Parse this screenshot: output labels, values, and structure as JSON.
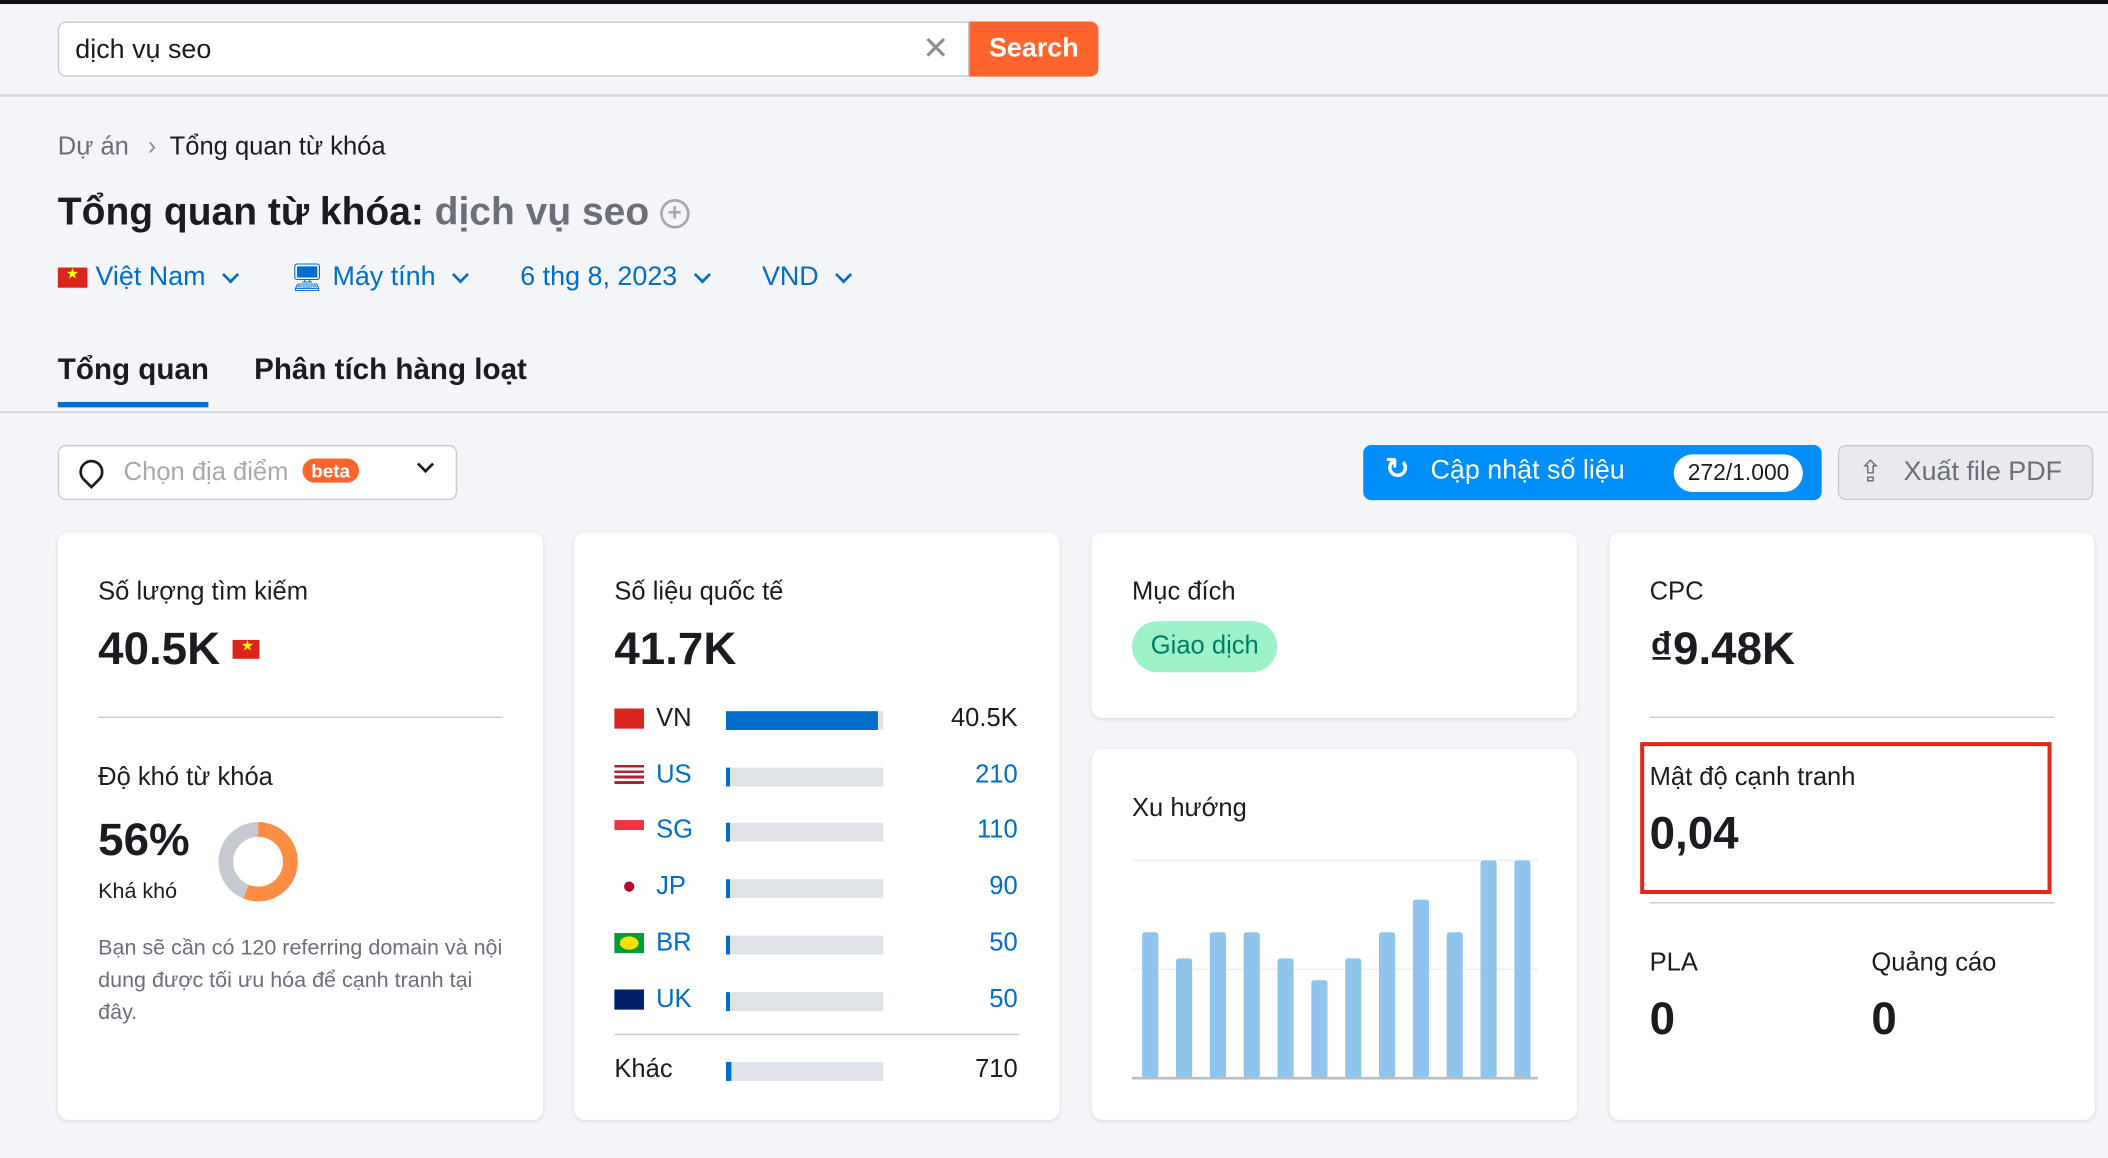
{
  "search": {
    "value": "dịch vụ seo",
    "button": "Search"
  },
  "breadcrumb": [
    "Dự án",
    "Tổng quan từ khóa"
  ],
  "title": {
    "label": "Tổng quan từ khóa:",
    "keyword": "dịch vụ seo"
  },
  "filters": {
    "country": "Việt Nam",
    "device": "Máy tính",
    "date": "6 thg 8, 2023",
    "currency": "VND"
  },
  "tabs": [
    "Tổng quan",
    "Phân tích hàng loạt"
  ],
  "location": {
    "placeholder": "Chọn địa điểm",
    "badge": "beta"
  },
  "update": {
    "label": "Cập nhật số liệu",
    "count": "272/1.000"
  },
  "export": {
    "label": "Xuất file PDF"
  },
  "volume": {
    "label": "Số lượng tìm kiếm",
    "value": "40.5K"
  },
  "difficulty": {
    "label": "Độ khó từ khóa",
    "value": "56%",
    "percent": 56,
    "level": "Khá khó",
    "note": "Bạn sẽ cần có 120 referring domain và nội dung được tối ưu hóa để cạnh tranh tại đây.",
    "color": "#ff8c43"
  },
  "global": {
    "label": "Số liệu quốc tế",
    "value": "41.7K",
    "rows": [
      {
        "code": "VN",
        "value": "40.5K",
        "share": 0.97
      },
      {
        "code": "US",
        "value": "210",
        "share": 0.02
      },
      {
        "code": "SG",
        "value": "110",
        "share": 0.02
      },
      {
        "code": "JP",
        "value": "90",
        "share": 0.02
      },
      {
        "code": "BR",
        "value": "50",
        "share": 0.02
      },
      {
        "code": "UK",
        "value": "50",
        "share": 0.02
      }
    ],
    "other": {
      "label": "Khác",
      "value": "710",
      "share": 0.02
    }
  },
  "intent": {
    "label": "Mục đích",
    "value": "Giao dịch"
  },
  "trend": {
    "label": "Xu hướng"
  },
  "chart_data": {
    "type": "bar",
    "values": [
      0.67,
      0.55,
      0.67,
      0.67,
      0.55,
      0.45,
      0.55,
      0.67,
      0.82,
      0.67,
      1,
      1
    ],
    "ylim": [
      0,
      1
    ],
    "grid": true,
    "color": "#8fc5ec"
  },
  "cpc": {
    "label": "CPC",
    "value": "₫9.48K"
  },
  "competition": {
    "label": "Mật độ cạnh tranh",
    "value": "0,04"
  },
  "pla": {
    "label": "PLA",
    "value": "0"
  },
  "ads": {
    "label": "Quảng cáo",
    "value": "0"
  }
}
